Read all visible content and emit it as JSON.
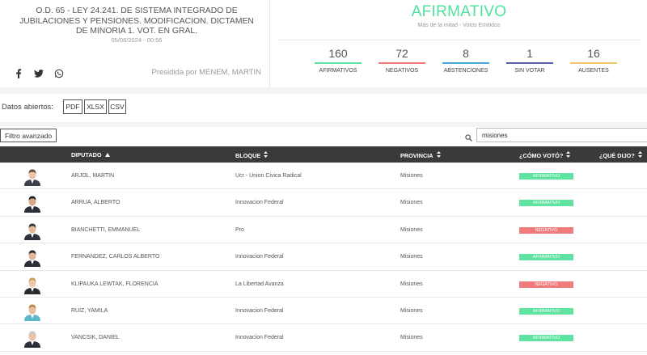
{
  "header": {
    "title": "O.D. 65 - LEY 24.241. DE SISTEMA INTEGRADO DE JUBILACIONES Y PENSIONES. MODIFICACION. DICTAMEN DE MINORIA 1. VOT. EN GRAL.",
    "datetime": "05/06/2024 - 00:56",
    "presidida": "Presidida por MENEM, MARTIN",
    "social": [
      "facebook-icon",
      "twitter-icon",
      "whatsapp-icon"
    ]
  },
  "result": {
    "label": "AFIRMATIVO",
    "subtitle": "Más de la mitad - Votos Emitidos",
    "color": "#4ee39d",
    "stats": [
      {
        "value": "160",
        "label": "AFIRMATIVOS",
        "color": "#5fe3a1"
      },
      {
        "value": "72",
        "label": "NEGATIVOS",
        "color": "#f07b7b"
      },
      {
        "value": "8",
        "label": "ABSTENCIONES",
        "color": "#46a6d6"
      },
      {
        "value": "1",
        "label": "SIN VOTAR",
        "color": "#5a5fa8"
      },
      {
        "value": "16",
        "label": "AUSENTES",
        "color": "#f2c46e"
      }
    ]
  },
  "opendata": {
    "label": "Datos abiertos:",
    "formats": [
      "PDF",
      "XLSX",
      "CSV"
    ]
  },
  "filter": {
    "button_label": "Filtro avanzado",
    "search_value": "misiones"
  },
  "table": {
    "headers": {
      "diputado": "DIPUTADO",
      "bloque": "BLOQUE",
      "provincia": "PROVINCIA",
      "voto": "¿CÓMO VOTÓ?",
      "dijo": "¿QUÉ DIJO?"
    },
    "rows": [
      {
        "diputado": "ARJOL, MARTIN",
        "bloque": "Ucr - Union Civica Radical",
        "provincia": "Misiones",
        "voto": "AFIRMATIVO"
      },
      {
        "diputado": "ARRUA, ALBERTO",
        "bloque": "Innovacion Federal",
        "provincia": "Misiones",
        "voto": "AFIRMATIVO"
      },
      {
        "diputado": "BIANCHETTI, EMMANUEL",
        "bloque": "Pro",
        "provincia": "Misiones",
        "voto": "NEGATIVO"
      },
      {
        "diputado": "FERNANDEZ, CARLOS ALBERTO",
        "bloque": "Innovacion Federal",
        "provincia": "Misiones",
        "voto": "AFIRMATIVO"
      },
      {
        "diputado": "KLIPAUKA LEWTAK, FLORENCIA",
        "bloque": "La Libertad Avanza",
        "provincia": "Misiones",
        "voto": "NEGATIVO"
      },
      {
        "diputado": "RUIZ, YAMILA",
        "bloque": "Innovacion Federal",
        "provincia": "Misiones",
        "voto": "AFIRMATIVO"
      },
      {
        "diputado": "VANCSIK, DANIEL",
        "bloque": "Innovacion Federal",
        "provincia": "Misiones",
        "voto": "AFIRMATIVO"
      }
    ],
    "vote_colors": {
      "AFIRMATIVO": "#5fe3a1",
      "NEGATIVO": "#f07b7b"
    }
  }
}
